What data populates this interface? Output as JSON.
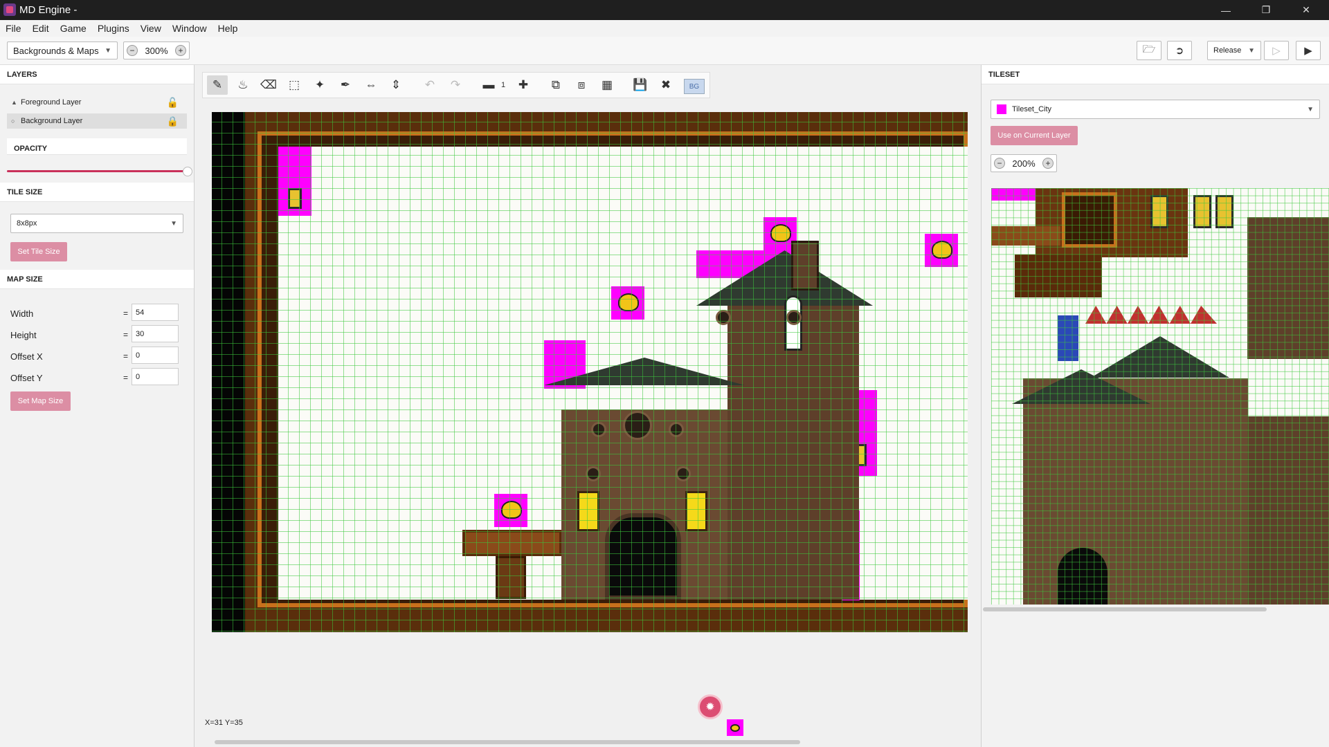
{
  "window": {
    "title": "MD Engine -"
  },
  "menu": [
    "File",
    "Edit",
    "Game",
    "Plugins",
    "View",
    "Window",
    "Help"
  ],
  "top_toolbar": {
    "mode_select": "Backgrounds & Maps",
    "zoom": "300%",
    "build_config": "Release"
  },
  "layers": {
    "heading": "LAYERS",
    "items": [
      {
        "label": "Foreground Layer"
      },
      {
        "label": "Background Layer"
      }
    ]
  },
  "opacity": {
    "heading": "OPACITY",
    "value": 1.0
  },
  "tile_size": {
    "heading": "TILE SIZE",
    "selected": "8x8px",
    "button": "Set Tile Size"
  },
  "map_size": {
    "heading": "MAP SIZE",
    "fields": [
      {
        "label": "Width",
        "value": "54"
      },
      {
        "label": "Height",
        "value": "30"
      },
      {
        "label": "Offset X",
        "value": "0"
      },
      {
        "label": "Offset Y",
        "value": "0"
      }
    ],
    "eq": "=",
    "button": "Set Map Size"
  },
  "editor_toolbar": {
    "brush_size": "1",
    "bg_toggle": "BG"
  },
  "status": {
    "cursor": "X=31 Y=35"
  },
  "tileset": {
    "heading": "TILESET",
    "selected": "Tileset_City",
    "use_button": "Use on Current Layer",
    "zoom": "200%"
  },
  "colors": {
    "accent": "#dc8ea4",
    "magenta_key": "#ff00ff",
    "grid": "#3cc83c",
    "titlebar": "#1f1f1f"
  }
}
